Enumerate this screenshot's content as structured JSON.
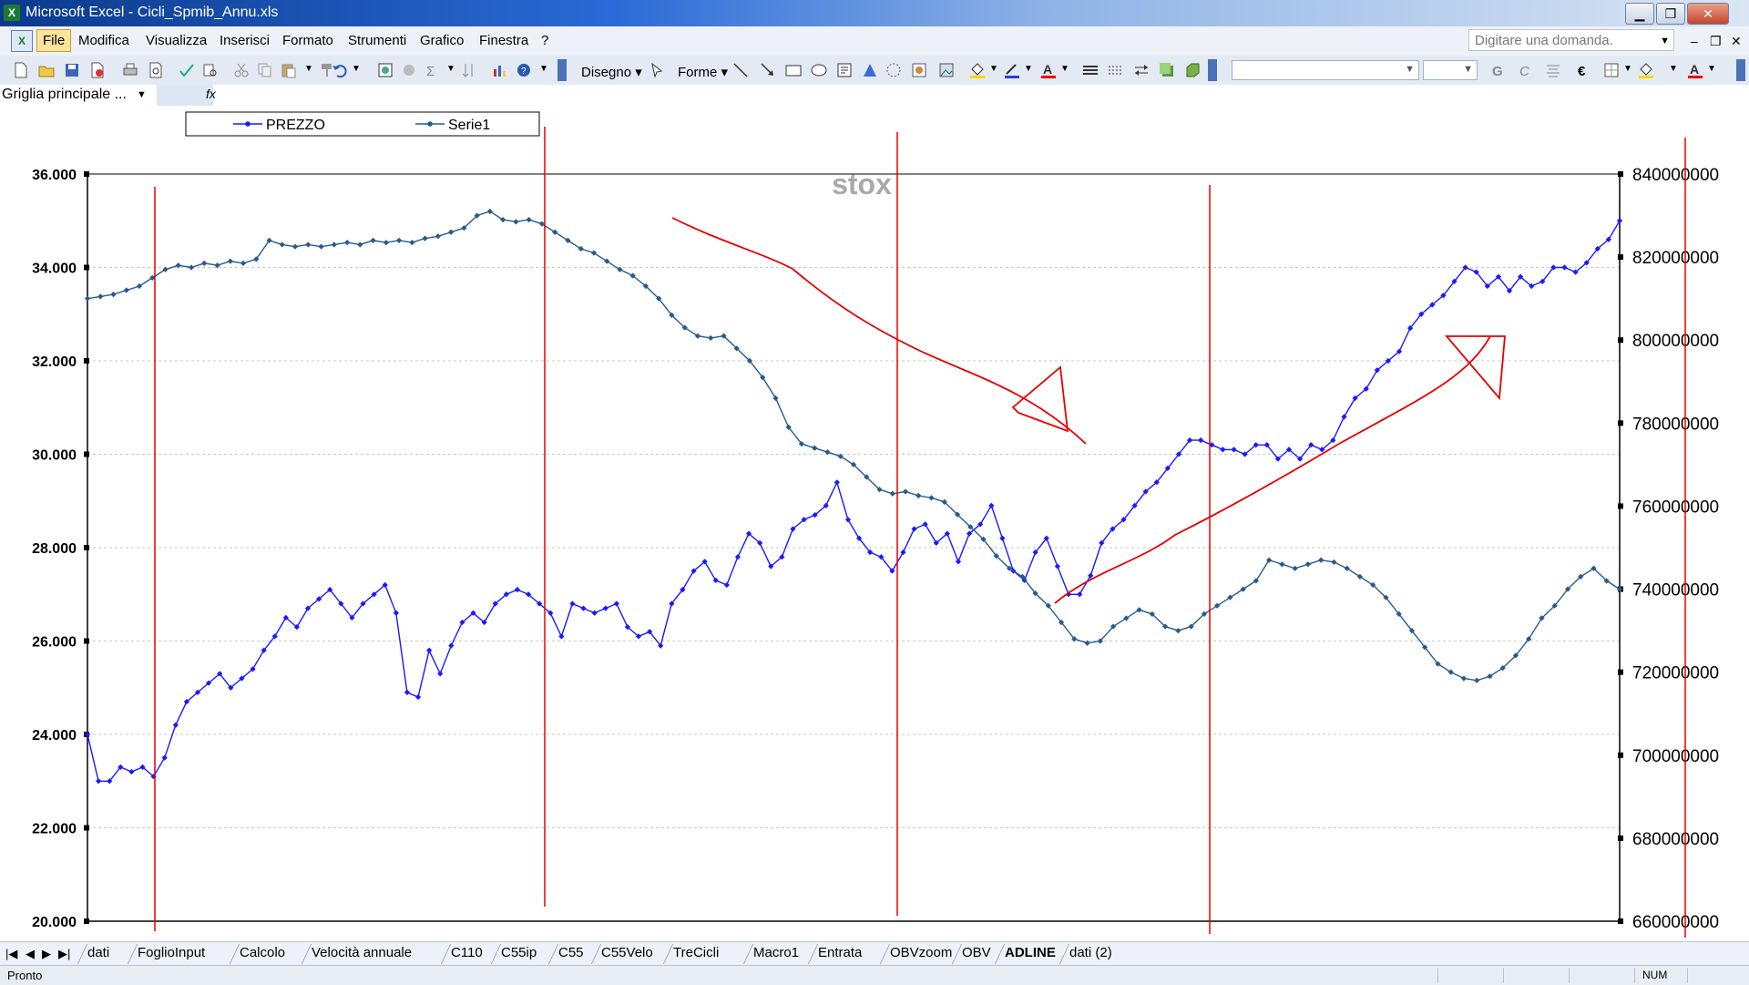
{
  "window": {
    "app_icon": "excel-icon",
    "title": "Microsoft Excel - Cicli_Spmib_Annu.xls",
    "minimize": "▁",
    "restore": "❐",
    "close": "✕"
  },
  "menubar": {
    "items": [
      "File",
      "Modifica",
      "Visualizza",
      "Inserisci",
      "Formato",
      "Strumenti",
      "Grafico",
      "Finestra",
      "?"
    ],
    "selected": "File",
    "help_placeholder": "Digitare una domanda.",
    "mdi_min": "–",
    "mdi_restore": "❐",
    "mdi_close": "✕"
  },
  "toolbar": {
    "disegno_label": "Disegno",
    "forme_label": "Forme",
    "bold_label": "G",
    "italic_label": "C",
    "euro_label": "€",
    "font_name": "",
    "font_size": ""
  },
  "formulabar": {
    "namebox": "Griglia principale ...",
    "fx": "fx"
  },
  "chart_data": {
    "type": "line",
    "title": "stox",
    "legend": [
      "PREZZO",
      "Serie1"
    ],
    "legend_position": "top-left",
    "y_left": {
      "min": 20000,
      "max": 36000,
      "step": 2000,
      "tick_labels": [
        "36.000",
        "34.000",
        "32.000",
        "30.000",
        "28.000",
        "26.000",
        "24.000",
        "22.000",
        "20.000"
      ]
    },
    "y_right": {
      "min": 660000000,
      "max": 840000000,
      "step": 20000000,
      "tick_labels": [
        "840000000",
        "820000000",
        "800000000",
        "780000000",
        "760000000",
        "740000000",
        "720000000",
        "700000000",
        "680000000",
        "660000000"
      ]
    },
    "gridlines": "horizontal dashed",
    "series": [
      {
        "name": "PREZZO",
        "axis": "left",
        "color": "#1a1aff",
        "values": [
          24000,
          23000,
          23000,
          23300,
          23200,
          23300,
          23100,
          23500,
          24200,
          24700,
          24900,
          25100,
          25300,
          25000,
          25200,
          25400,
          25800,
          26100,
          26500,
          26300,
          26700,
          26900,
          27100,
          26800,
          26500,
          26800,
          27000,
          27200,
          26600,
          24900,
          24800,
          25800,
          25300,
          25900,
          26400,
          26600,
          26400,
          26800,
          27000,
          27100,
          27000,
          26800,
          26600,
          26100,
          26800,
          26700,
          26600,
          26700,
          26800,
          26300,
          26100,
          26200,
          25900,
          26800,
          27100,
          27500,
          27700,
          27300,
          27200,
          27800,
          28300,
          28100,
          27600,
          27800,
          28400,
          28600,
          28700,
          28900,
          29400,
          28600,
          28200,
          27900,
          27800,
          27500,
          27900,
          28400,
          28500,
          28100,
          28300,
          27700,
          28300,
          28500,
          28900,
          28200,
          27500,
          27300,
          27900,
          28200,
          27600,
          27000,
          27000,
          27400,
          28100,
          28400,
          28600,
          28900,
          29200,
          29400,
          29700,
          30000,
          30300,
          30300,
          30200,
          30100,
          30100,
          30000,
          30200,
          30200,
          29900,
          30100,
          29900,
          30200,
          30100,
          30300,
          30800,
          31200,
          31400,
          31800,
          32000,
          32200,
          32700,
          33000,
          33200,
          33400,
          33700,
          34000,
          33900,
          33600,
          33800,
          33500,
          33800,
          33600,
          33700,
          34000,
          34000,
          33900,
          34100,
          34400,
          34600,
          35000
        ]
      },
      {
        "name": "Serie1",
        "axis": "right",
        "color": "#2a5a8c",
        "values": [
          810000000,
          810500000,
          811000000,
          812000000,
          813000000,
          815000000,
          817000000,
          818000000,
          817500000,
          818500000,
          818000000,
          819000000,
          818500000,
          819500000,
          824000000,
          823000000,
          822500000,
          823000000,
          822500000,
          823000000,
          823500000,
          823000000,
          824000000,
          823500000,
          824000000,
          823500000,
          824500000,
          825000000,
          826000000,
          827000000,
          830000000,
          831000000,
          829000000,
          828500000,
          829000000,
          828000000,
          826000000,
          824000000,
          822000000,
          821000000,
          819000000,
          817000000,
          815500000,
          813000000,
          810000000,
          806000000,
          803000000,
          801000000,
          800500000,
          801000000,
          798000000,
          795000000,
          791000000,
          786000000,
          779000000,
          775000000,
          774000000,
          773000000,
          772000000,
          770000000,
          767000000,
          764000000,
          763000000,
          763500000,
          762500000,
          762000000,
          761000000,
          758000000,
          755000000,
          752000000,
          748000000,
          745000000,
          743000000,
          739000000,
          736000000,
          732000000,
          728000000,
          727000000,
          727500000,
          731000000,
          733000000,
          735000000,
          734000000,
          731000000,
          730000000,
          731000000,
          734000000,
          736000000,
          738000000,
          740000000,
          742000000,
          747000000,
          746000000,
          745000000,
          746000000,
          747000000,
          746500000,
          745000000,
          743000000,
          741000000,
          738000000,
          734000000,
          730000000,
          726000000,
          722000000,
          720000000,
          718500000,
          718000000,
          719000000,
          721000000,
          724000000,
          728000000,
          733000000,
          736000000,
          740000000,
          743000000,
          745000000,
          742000000,
          740000000
        ]
      }
    ]
  },
  "sheettabs": {
    "tabs": [
      "dati",
      "FoglioInput",
      "Calcolo",
      "Velocità annuale",
      "C110",
      "C55ip",
      "C55",
      "C55Velo",
      "TreCicli",
      "Macro1",
      "Entrata",
      "OBVzoom",
      "OBV",
      "ADLINE",
      "dati (2)"
    ],
    "active": "ADLINE"
  },
  "statusbar": {
    "status": "Pronto",
    "num": "NUM"
  }
}
